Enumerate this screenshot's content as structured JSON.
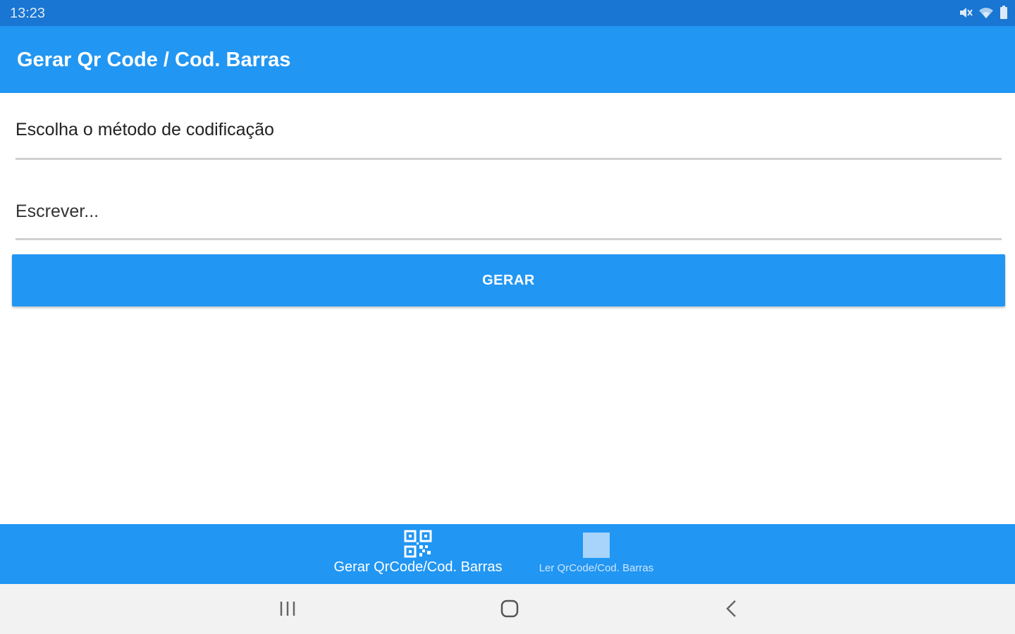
{
  "status_bar": {
    "time": "13:23",
    "icons": [
      "mute-icon",
      "wifi-icon",
      "battery-icon"
    ]
  },
  "app_bar": {
    "title": "Gerar Qr Code / Cod. Barras"
  },
  "form": {
    "method_select": {
      "value": "Escolha o método de codificação"
    },
    "text_input": {
      "placeholder": "Escrever...",
      "value": ""
    },
    "generate_button_label": "GERAR"
  },
  "bottom_nav": {
    "items": [
      {
        "label": "Gerar QrCode/Cod. Barras",
        "icon": "qr-code-icon",
        "active": true
      },
      {
        "label": "Ler QrCode/Cod. Barras",
        "icon": "scan-placeholder-icon",
        "active": false
      }
    ]
  },
  "system_nav": {
    "icons": [
      "recents-icon",
      "home-icon",
      "back-icon"
    ]
  },
  "colors": {
    "status_bar": "#1976d2",
    "primary": "#2196f3",
    "text": "#222222",
    "divider": "#d0d0d0",
    "system_nav_bg": "#f2f2f2"
  }
}
